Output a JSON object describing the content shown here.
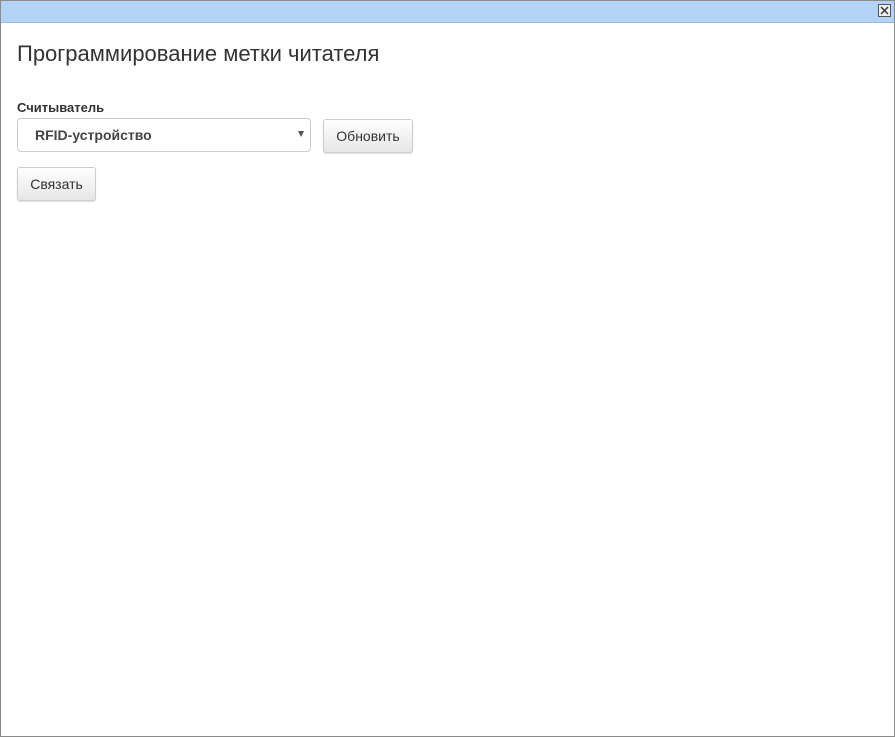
{
  "window": {
    "close_icon": "close-icon",
    "titlebar_color": "#b4d4f7"
  },
  "page": {
    "title": "Программирование метки читателя"
  },
  "reader": {
    "label": "Считыватель",
    "selected_value": "RFID-устройство",
    "refresh_label": "Обновить"
  },
  "actions": {
    "bind_label": "Связать"
  }
}
